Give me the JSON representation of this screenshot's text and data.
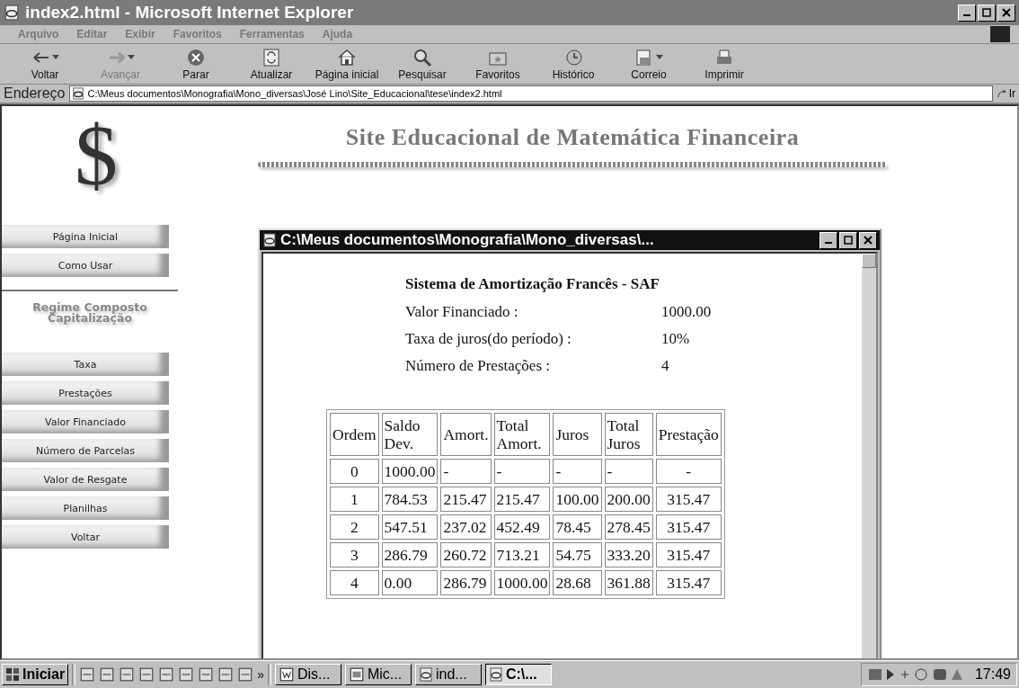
{
  "window": {
    "title": "index2.html - Microsoft Internet Explorer"
  },
  "menu": [
    "Arquivo",
    "Editar",
    "Exibir",
    "Favoritos",
    "Ferramentas",
    "Ajuda"
  ],
  "toolbar": [
    {
      "kind": "back",
      "label": "Voltar",
      "disabled": false,
      "dropdown": true
    },
    {
      "kind": "forward",
      "label": "Avançar",
      "disabled": true,
      "dropdown": true
    },
    {
      "kind": "stop",
      "label": "Parar",
      "disabled": false,
      "dropdown": false
    },
    {
      "kind": "refresh",
      "label": "Atualizar",
      "disabled": false,
      "dropdown": false
    },
    {
      "kind": "home",
      "label": "Página inicial",
      "disabled": false,
      "dropdown": false
    },
    {
      "kind": "search",
      "label": "Pesquisar",
      "disabled": false,
      "dropdown": false
    },
    {
      "kind": "favorites",
      "label": "Favoritos",
      "disabled": false,
      "dropdown": false
    },
    {
      "kind": "history",
      "label": "Histórico",
      "disabled": false,
      "dropdown": false
    },
    {
      "kind": "mail",
      "label": "Correio",
      "disabled": false,
      "dropdown": true
    },
    {
      "kind": "print",
      "label": "Imprimir",
      "disabled": false,
      "dropdown": false
    }
  ],
  "address": {
    "label": "Endereço",
    "value": "C:\\Meus documentos\\Monografia\\Mono_diversas\\José Lino\\Site_Educacional\\tese\\index2.html",
    "go": "Ir"
  },
  "sidebar": {
    "logo": "$",
    "items": [
      {
        "kind": "button",
        "label": "Página Inicial"
      },
      {
        "kind": "button",
        "label": "Como Usar"
      },
      {
        "kind": "rule"
      },
      {
        "kind": "heading",
        "label": "Regime Composto\nCapitalização"
      },
      {
        "kind": "button",
        "label": "Taxa"
      },
      {
        "kind": "button",
        "label": "Prestações"
      },
      {
        "kind": "button",
        "label": "Valor Financiado"
      },
      {
        "kind": "button",
        "label": "Número de Parcelas"
      },
      {
        "kind": "button",
        "label": "Valor de Resgate"
      },
      {
        "kind": "button",
        "label": "Planilhas"
      },
      {
        "kind": "button",
        "label": "Voltar"
      }
    ]
  },
  "site_title": "Site Educacional de Matemática Financeira",
  "popup": {
    "title": "C:\\Meus documentos\\Monografia\\Mono_diversas\\...",
    "heading": "Sistema de Amortização Francês - SAF",
    "info": [
      {
        "label": "Valor Financiado :",
        "value": "1000.00"
      },
      {
        "label": "Taxa de juros(do período) :",
        "value": "10%"
      },
      {
        "label": "Número de Prestações :",
        "value": "4"
      }
    ],
    "table": {
      "columns": [
        "Ordem",
        "Saldo Dev.",
        "Amort.",
        "Total Amort.",
        "Juros",
        "Total Juros",
        "Prestação"
      ],
      "rows": [
        [
          "0",
          "1000.00",
          "-",
          "-",
          "-",
          "-",
          "-"
        ],
        [
          "1",
          "784.53",
          "215.47",
          "215.47",
          "100.00",
          "200.00",
          "315.47"
        ],
        [
          "2",
          "547.51",
          "237.02",
          "452.49",
          "78.45",
          "278.45",
          "315.47"
        ],
        [
          "3",
          "286.79",
          "260.72",
          "713.21",
          "54.75",
          "333.20",
          "315.47"
        ],
        [
          "4",
          "0.00",
          "286.79",
          "1000.00",
          "28.68",
          "361.88",
          "315.47"
        ]
      ]
    }
  },
  "taskbar": {
    "start": "Iniciar",
    "more": "»",
    "tasks": [
      {
        "label": "Dis...",
        "kind": "word",
        "selected": false
      },
      {
        "label": "Mic...",
        "kind": "ppt",
        "selected": false
      },
      {
        "label": "ind...",
        "kind": "ie",
        "selected": false
      },
      {
        "label": "C:\\...",
        "kind": "ie",
        "selected": true
      }
    ],
    "clock": "17:49"
  }
}
